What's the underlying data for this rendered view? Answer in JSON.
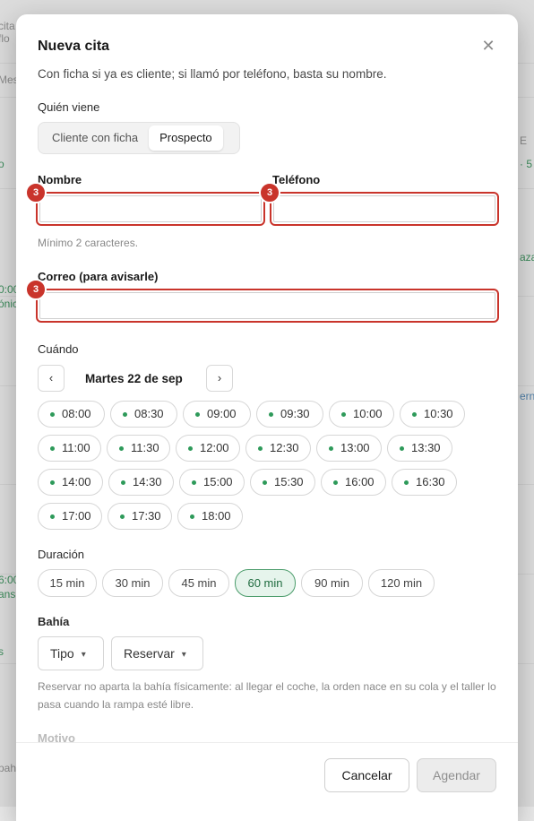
{
  "background": {
    "snippets": [
      "cita",
      "flo",
      "Mes",
      "o",
      "0:00",
      "ónic",
      "aza",
      "E",
      "· 5",
      "erna",
      "6:00",
      "ans",
      "s",
      "pahi"
    ]
  },
  "modal": {
    "title": "Nueva cita",
    "subtitle": "Con ficha si ya es cliente; si llamó por teléfono, basta su nombre.",
    "who": {
      "label": "Quién viene",
      "options": [
        "Cliente con ficha",
        "Prospecto"
      ],
      "selected": "Prospecto"
    },
    "fields": {
      "name_label": "Nombre",
      "phone_label": "Teléfono",
      "email_label": "Correo (para avisarle)",
      "name_hint": "Mínimo 2 caracteres.",
      "error_count": "3"
    },
    "when": {
      "label": "Cuándo",
      "prev": "‹",
      "next": "›",
      "date": "Martes 22 de sep",
      "slots": [
        "08:00",
        "08:30",
        "09:00",
        "09:30",
        "10:00",
        "10:30",
        "11:00",
        "11:30",
        "12:00",
        "12:30",
        "13:00",
        "13:30",
        "14:00",
        "14:30",
        "15:00",
        "15:30",
        "16:00",
        "16:30",
        "17:00",
        "17:30",
        "18:00"
      ]
    },
    "duration": {
      "label": "Duración",
      "options": [
        "15 min",
        "30 min",
        "45 min",
        "60 min",
        "90 min",
        "120 min"
      ],
      "selected": "60 min"
    },
    "bay": {
      "label": "Bahía",
      "type_select": "Tipo",
      "reserve_select": "Reservar",
      "note": "Reservar no aparta la bahía físicamente: al llegar el coche, la orden nace en su cola y el taller lo pasa cuando la rampa esté libre."
    },
    "reason_label": "Motivo",
    "actions": {
      "cancel": "Cancelar",
      "submit": "Agendar"
    },
    "colors": {
      "error": "#c9342b",
      "available_dot": "#2e9a5a",
      "selected_bg": "#e6f4ec"
    }
  }
}
